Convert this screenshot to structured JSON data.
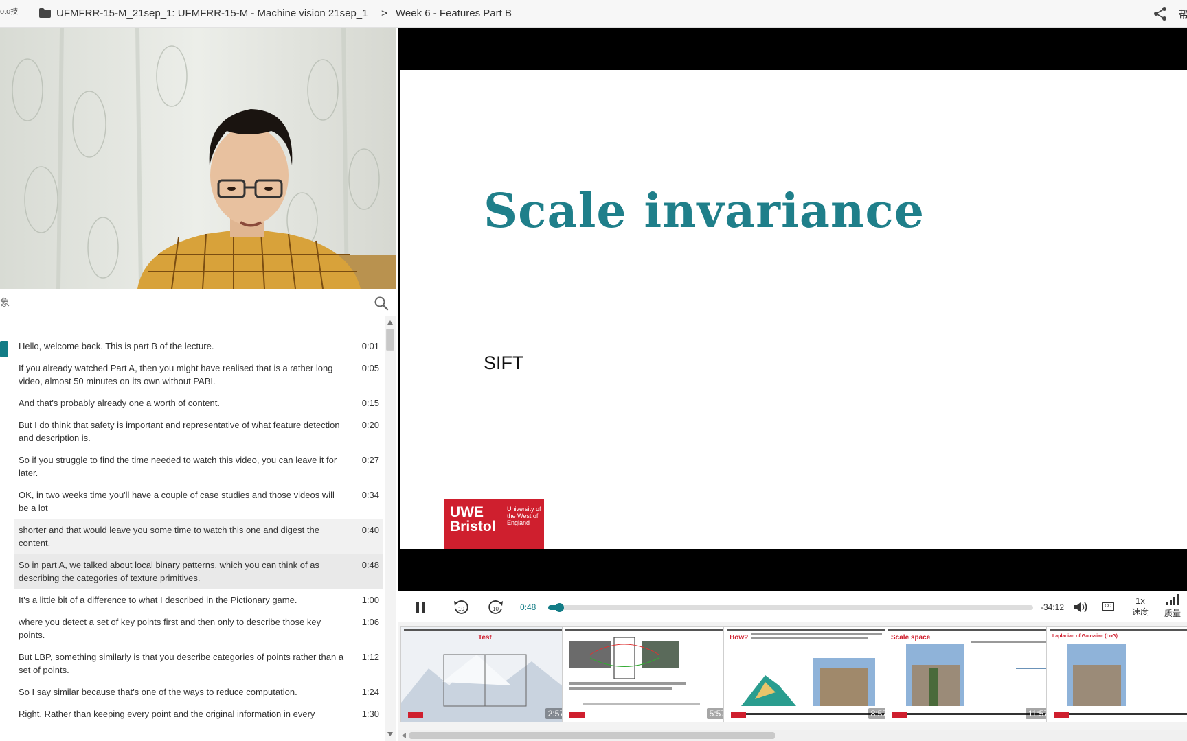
{
  "topbar": {
    "cutoff_text": "oto技",
    "breadcrumb_course": "UFMFRR-15-M_21sep_1: UFMFRR-15-M - Machine vision 21sep_1",
    "breadcrumb_separator": ">",
    "breadcrumb_video": "Week 6 - Features Part B",
    "help_cutoff": "帮"
  },
  "search": {
    "placeholder": "象"
  },
  "transcript": [
    {
      "text": "Hello, welcome back. This is part B of the lecture.",
      "time": "0:01"
    },
    {
      "text": "If you already watched Part A, then you might have realised that is a rather long video, almost 50 minutes on its own without PABI.",
      "time": "0:05"
    },
    {
      "text": "And that's probably already one a worth of content.",
      "time": "0:15"
    },
    {
      "text": "But I do think that safety is important and representative of what feature detection and description is.",
      "time": "0:20"
    },
    {
      "text": "So if you struggle to find the time needed to watch this video, you can leave it for later.",
      "time": "0:27"
    },
    {
      "text": "OK, in two weeks time you'll have a couple of case studies and those videos will be a lot",
      "time": "0:34"
    },
    {
      "text": "shorter and that would leave you some time to watch this one and digest the content.",
      "time": "0:40"
    },
    {
      "text": "So in part A, we talked about local binary patterns, which you can think of as describing the categories of texture primitives.",
      "time": "0:48"
    },
    {
      "text": "It's a little bit of a difference to what I described in the Pictionary game.",
      "time": "1:00"
    },
    {
      "text": "where you detect a set of key points first and then only to describe those key points.",
      "time": "1:06"
    },
    {
      "text": "But LBP, something similarly is that you describe categories of points rather than a set of points.",
      "time": "1:12"
    },
    {
      "text": "So I say similar because that's one of the ways to reduce computation.",
      "time": "1:24"
    },
    {
      "text": "Right. Rather than keeping every point and the original information in every",
      "time": "1:30"
    }
  ],
  "slide": {
    "title": "Scale invariance",
    "subtitle": "SIFT",
    "logo_main": "UWE Bristol",
    "logo_sub": "University of the West of England"
  },
  "controls": {
    "current_time": "0:48",
    "remaining_time": "-34:12",
    "progress_fraction": 0.023,
    "rewind_label": "10",
    "forward_label": "10",
    "cc_label": "CC",
    "speed_value": "1x",
    "speed_label": "速度",
    "quality_label": "质量"
  },
  "thumbnails": [
    {
      "title": "Test",
      "duration": "2:57"
    },
    {
      "title": "",
      "duration": "5:57"
    },
    {
      "title": "How?",
      "duration": "8:57"
    },
    {
      "title": "Scale space",
      "duration": "11:57"
    },
    {
      "title": "Laplacian of Gaussian (LoG)",
      "duration": ""
    }
  ],
  "colors": {
    "accent": "#127c86",
    "uwe_red": "#cf1f2e",
    "slide_title": "#1f7f8a"
  }
}
